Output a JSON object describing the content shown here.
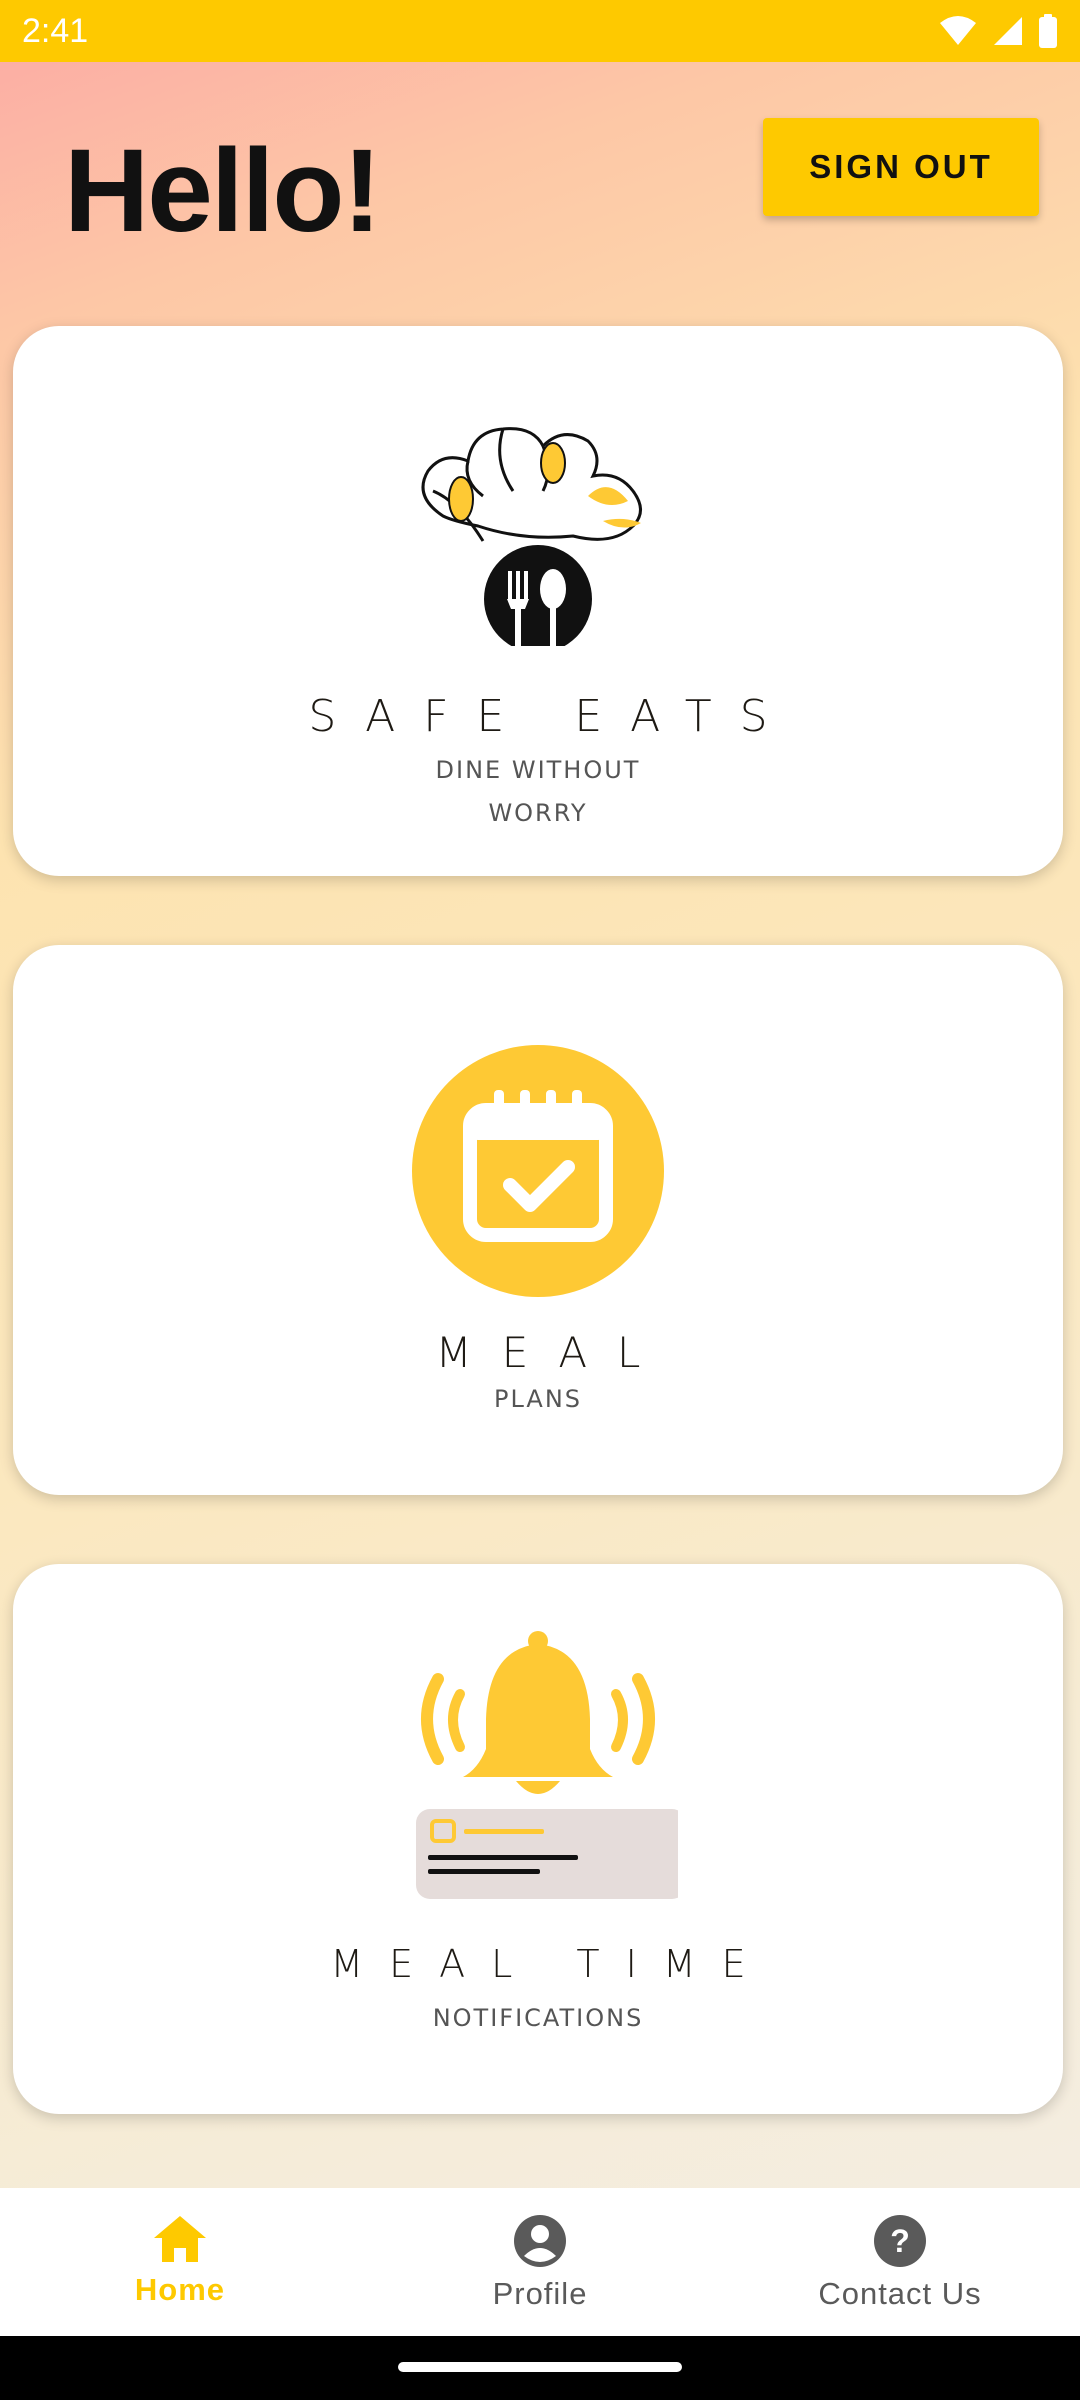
{
  "status_bar": {
    "time": "2:41",
    "icons": [
      "wifi-icon",
      "signal-icon",
      "battery-icon"
    ]
  },
  "header": {
    "greeting": "Hello!",
    "sign_out_label": "SIGN OUT"
  },
  "cards": [
    {
      "title": "SAFE EATS",
      "subtitle_line1": "DINE WITHOUT",
      "subtitle_line2": "WORRY",
      "icon": "chef-hat-icon"
    },
    {
      "title": "MEAL",
      "subtitle": "PLANS",
      "icon": "calendar-check-icon"
    },
    {
      "title": "MEAL TIME",
      "subtitle": "NOTIFICATIONS",
      "icon": "bell-notification-icon"
    }
  ],
  "bottom_nav": {
    "items": [
      {
        "label": "Home",
        "icon": "home-icon",
        "active": true
      },
      {
        "label": "Profile",
        "icon": "profile-icon",
        "active": false
      },
      {
        "label": "Contact Us",
        "icon": "help-icon",
        "active": false
      }
    ]
  },
  "colors": {
    "accent": "#fec900",
    "status_bar": "#fec900",
    "text": "#111111"
  }
}
